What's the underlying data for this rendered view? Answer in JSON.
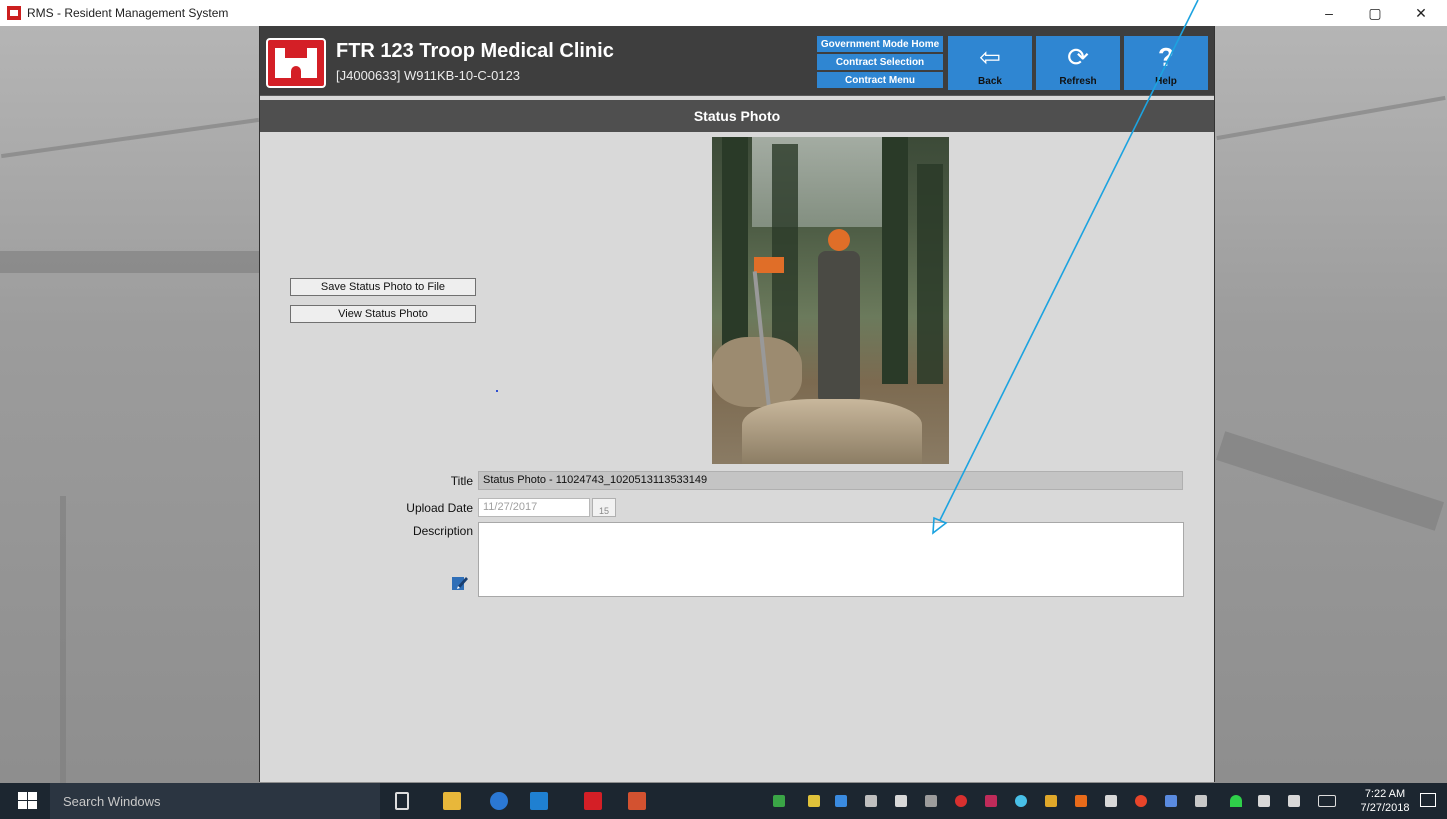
{
  "window": {
    "title": "RMS - Resident Management System",
    "minimize": "–",
    "maximize": "▢",
    "close": "✕"
  },
  "header": {
    "clinic_name": "FTR 123 Troop Medical Clinic",
    "contract_id": "[J4000633] W911KB-10-C-0123",
    "nav": {
      "gov_home": "Government Mode Home",
      "contract_selection": "Contract Selection",
      "contract_menu": "Contract Menu"
    },
    "buttons": {
      "back": "Back",
      "refresh": "Refresh",
      "help": "Help"
    },
    "icons": {
      "back": "⇦",
      "refresh": "⟳",
      "help": "?"
    }
  },
  "section": {
    "title": "Status Photo"
  },
  "actions": {
    "save_photo": "Save Status Photo to File",
    "view_photo": "View Status Photo"
  },
  "form": {
    "title_label": "Title",
    "title_value": "Status Photo - 11024743_1020513113533149",
    "upload_label": "Upload Date",
    "upload_value": "11/27/2017",
    "calendar_day": "15",
    "description_label": "Description",
    "description_value": ""
  },
  "taskbar": {
    "search_placeholder": "Search Windows",
    "time": "7:22 AM",
    "date": "7/27/2018"
  },
  "colors": {
    "accent_blue": "#2f86d2",
    "header_dark": "#3e3e3e",
    "logo_red": "#d41f26",
    "annotation_arrow": "#1ca3e0"
  }
}
